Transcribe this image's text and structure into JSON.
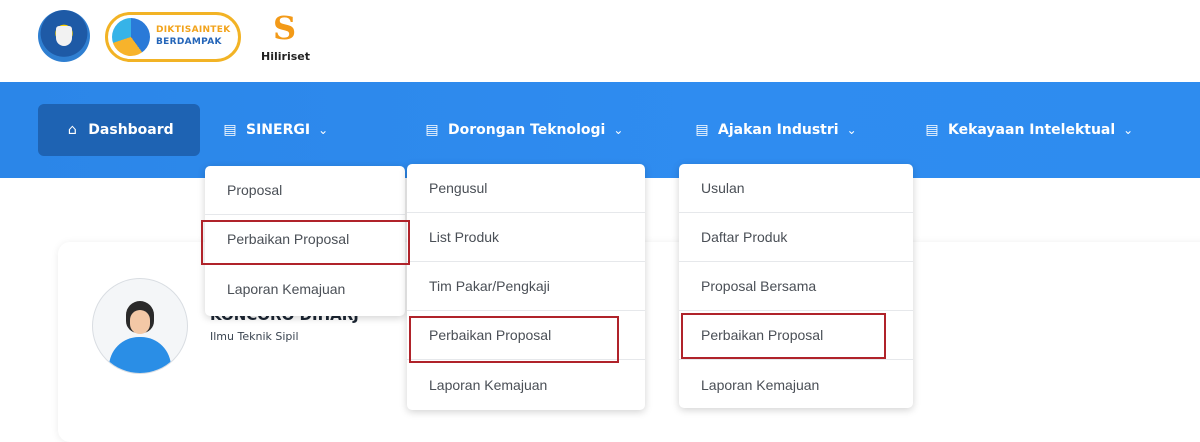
{
  "logos": {
    "diktis_line1": "DIKTISAINTEK",
    "diktis_line2": "BERDAMPAK",
    "hiliriset": "Hiliriset"
  },
  "nav": {
    "dashboard": "Dashboard",
    "sinergi": "SINERGI",
    "dorongan": "Dorongan Teknologi",
    "ajakan": "Ajakan Industri",
    "kekayaan": "Kekayaan Intelektual"
  },
  "dropdown_sinergi": [
    "Proposal",
    "Perbaikan Proposal",
    "Laporan Kemajuan"
  ],
  "dropdown_dorongan": [
    "Pengusul",
    "List Produk",
    "Tim Pakar/Pengkaji",
    "Perbaikan Proposal",
    "Laporan Kemajuan"
  ],
  "dropdown_ajakan": [
    "Usulan",
    "Daftar Produk",
    "Proposal Bersama",
    "Perbaikan Proposal",
    "Laporan Kemajuan"
  ],
  "profile": {
    "name": "KONCORO DIHARJ",
    "department": "Ilmu Teknik Sipil"
  }
}
